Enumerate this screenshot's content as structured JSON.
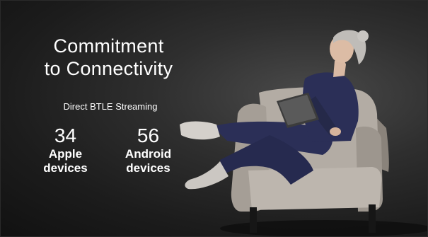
{
  "slide": {
    "title_line1": "Commitment",
    "title_line2": "to Connectivity",
    "subtitle": "Direct BTLE Streaming",
    "stats": [
      {
        "number": "34",
        "label_line1": "Apple",
        "label_line2": "devices"
      },
      {
        "number": "56",
        "label_line1": "Android",
        "label_line2": "devices"
      }
    ]
  },
  "colors": {
    "background": "#1c1c1c",
    "text": "#ffffff",
    "chair": "#b3aca4",
    "clothing": "#2b2f57"
  }
}
